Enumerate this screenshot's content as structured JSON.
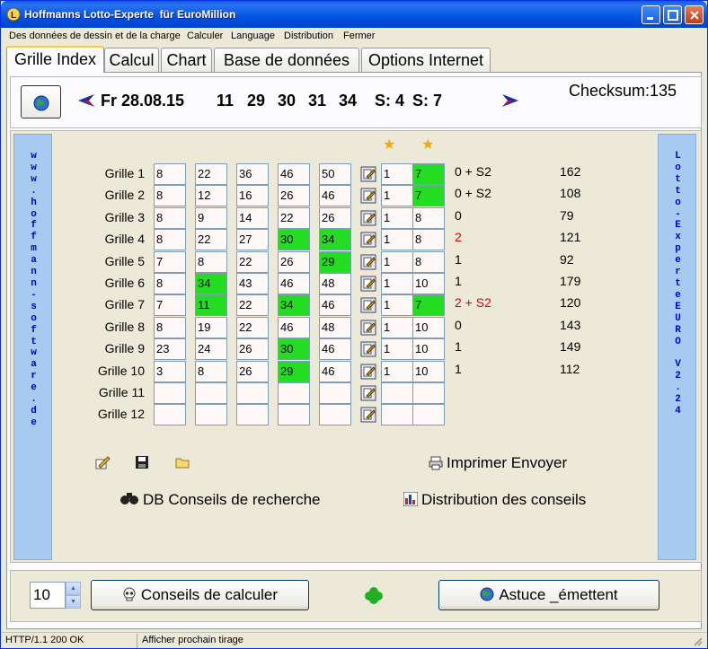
{
  "window": {
    "title": "Hoffmanns Lotto-Experte  für EuroMillion"
  },
  "menu": [
    "Des données de dessin et de la charge",
    "Calculer",
    "Language",
    "Distribution",
    "Fermer"
  ],
  "tabs": [
    "Grille Index",
    "Calcul",
    "Chart",
    "Base de données",
    "Options Internet"
  ],
  "active_tab": "Grille Index",
  "draw": {
    "date": "Fr 28.08.15",
    "numbers": [
      "11",
      "29",
      "30",
      "31",
      "34"
    ],
    "stars": [
      "S: 4",
      "S: 7"
    ],
    "checksum": "Checksum:135"
  },
  "side_left": "www.hoffmann-software.de",
  "side_right": "Lotto-ExperteEURO V2.24",
  "star_symbol": "★",
  "grids": [
    {
      "label": "Grille 1",
      "numbers": [
        "8",
        "22",
        "36",
        "46",
        "50"
      ],
      "stars": [
        "1",
        "7"
      ],
      "hits": [
        false,
        false,
        false,
        false,
        false
      ],
      "star_hits": [
        false,
        true
      ],
      "result": "0 + S2",
      "result_red": false,
      "sum": "162"
    },
    {
      "label": "Grille 2",
      "numbers": [
        "8",
        "12",
        "16",
        "26",
        "46"
      ],
      "stars": [
        "1",
        "7"
      ],
      "hits": [
        false,
        false,
        false,
        false,
        false
      ],
      "star_hits": [
        false,
        true
      ],
      "result": "0 + S2",
      "result_red": false,
      "sum": "108"
    },
    {
      "label": "Grille 3",
      "numbers": [
        "8",
        "9",
        "14",
        "22",
        "26"
      ],
      "stars": [
        "1",
        "8"
      ],
      "hits": [
        false,
        false,
        false,
        false,
        false
      ],
      "star_hits": [
        false,
        false
      ],
      "result": "0",
      "result_red": false,
      "sum": "79"
    },
    {
      "label": "Grille 4",
      "numbers": [
        "8",
        "22",
        "27",
        "30",
        "34"
      ],
      "stars": [
        "1",
        "8"
      ],
      "hits": [
        false,
        false,
        false,
        true,
        true
      ],
      "star_hits": [
        false,
        false
      ],
      "result": "2",
      "result_red": true,
      "sum": "121"
    },
    {
      "label": "Grille 5",
      "numbers": [
        "7",
        "8",
        "22",
        "26",
        "29"
      ],
      "stars": [
        "1",
        "8"
      ],
      "hits": [
        false,
        false,
        false,
        false,
        true
      ],
      "star_hits": [
        false,
        false
      ],
      "result": "1",
      "result_red": false,
      "sum": "92"
    },
    {
      "label": "Grille 6",
      "numbers": [
        "8",
        "34",
        "43",
        "46",
        "48"
      ],
      "stars": [
        "1",
        "10"
      ],
      "hits": [
        false,
        true,
        false,
        false,
        false
      ],
      "star_hits": [
        false,
        false
      ],
      "result": "1",
      "result_red": false,
      "sum": "179"
    },
    {
      "label": "Grille 7",
      "numbers": [
        "7",
        "11",
        "22",
        "34",
        "46"
      ],
      "stars": [
        "1",
        "7"
      ],
      "hits": [
        false,
        true,
        false,
        true,
        false
      ],
      "star_hits": [
        false,
        true
      ],
      "result": "2 + S2",
      "result_red": true,
      "sum": "120"
    },
    {
      "label": "Grille 8",
      "numbers": [
        "8",
        "19",
        "22",
        "46",
        "48"
      ],
      "stars": [
        "1",
        "10"
      ],
      "hits": [
        false,
        false,
        false,
        false,
        false
      ],
      "star_hits": [
        false,
        false
      ],
      "result": "0",
      "result_red": false,
      "sum": "143"
    },
    {
      "label": "Grille 9",
      "numbers": [
        "23",
        "24",
        "26",
        "30",
        "46"
      ],
      "stars": [
        "1",
        "10"
      ],
      "hits": [
        false,
        false,
        false,
        true,
        false
      ],
      "star_hits": [
        false,
        false
      ],
      "result": "1",
      "result_red": false,
      "sum": "149"
    },
    {
      "label": "Grille 10",
      "numbers": [
        "3",
        "8",
        "26",
        "29",
        "46"
      ],
      "stars": [
        "1",
        "10"
      ],
      "hits": [
        false,
        false,
        false,
        true,
        false
      ],
      "star_hits": [
        false,
        false
      ],
      "result": "1",
      "result_red": false,
      "sum": "112"
    },
    {
      "label": "Grille 11",
      "numbers": [
        "",
        "",
        "",
        "",
        ""
      ],
      "stars": [
        "",
        ""
      ],
      "hits": [
        false,
        false,
        false,
        false,
        false
      ],
      "star_hits": [
        false,
        false
      ],
      "result": "",
      "result_red": false,
      "sum": ""
    },
    {
      "label": "Grille 12",
      "numbers": [
        "",
        "",
        "",
        "",
        ""
      ],
      "stars": [
        "",
        ""
      ],
      "hits": [
        false,
        false,
        false,
        false,
        false
      ],
      "star_hits": [
        false,
        false
      ],
      "result": "",
      "result_red": false,
      "sum": ""
    }
  ],
  "actions": {
    "print_send": "Imprimer Envoyer",
    "db_tips": "DB Conseils de recherche",
    "tips_distribution": "Distribution des conseils"
  },
  "bottom": {
    "count_value": "10",
    "calc_button": "Conseils de calculer",
    "tip_button": "Astuce _émettent"
  },
  "status": [
    "HTTP/1.1 200 OK",
    "Afficher prochain tirage"
  ],
  "colors": {
    "hit": "#22dd22",
    "result_red": "#dd0000",
    "side_strip": "#a6caf0",
    "side_text": "#0000cc",
    "titlebar": "#0054e3"
  }
}
